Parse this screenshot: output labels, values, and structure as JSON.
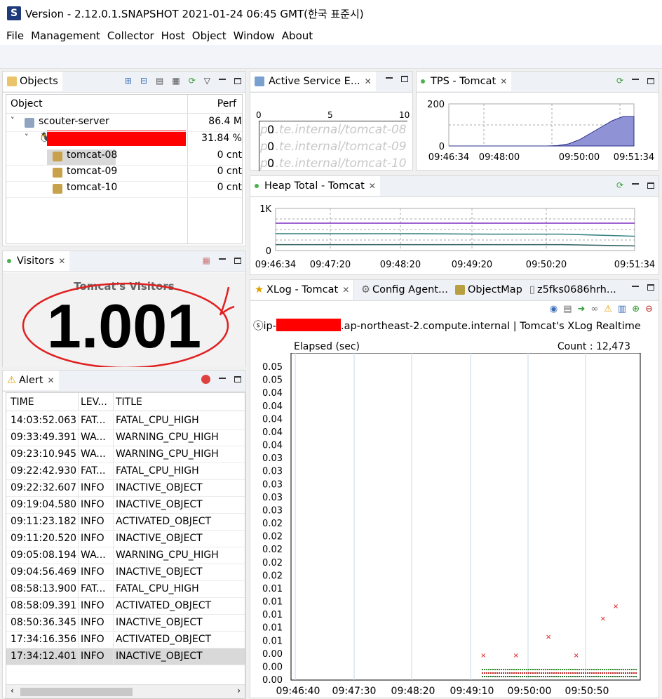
{
  "window": {
    "title": "Version - 2.12.0.1.SNAPSHOT 2021-01-24 06:45 GMT(한국 표준시)"
  },
  "menu": [
    "File",
    "Management",
    "Collector",
    "Host",
    "Object",
    "Window",
    "About"
  ],
  "objects": {
    "tab": "Objects",
    "col_object": "Object",
    "col_perf": "Perf",
    "rows": [
      {
        "name": "scouter-server",
        "perf": "86.4 M",
        "level": 0
      },
      {
        "name": "",
        "perf": "31.84 %",
        "level": 1
      },
      {
        "name": "tomcat-08",
        "perf": "0 cnt",
        "level": 2
      },
      {
        "name": "tomcat-09",
        "perf": "0 cnt",
        "level": 2
      },
      {
        "name": "tomcat-10",
        "perf": "0 cnt",
        "level": 2
      }
    ]
  },
  "visitors": {
    "tab": "Visitors",
    "heading": "Tomcat's  Visitors",
    "value": "1.001"
  },
  "alert": {
    "tab": "Alert",
    "cols": [
      "TIME",
      "LEV...",
      "TITLE"
    ],
    "rows": [
      [
        "14:03:52.063",
        "FAT...",
        "FATAL_CPU_HIGH"
      ],
      [
        "09:33:49.391",
        "WA...",
        "WARNING_CPU_HIGH"
      ],
      [
        "09:23:10.945",
        "WA...",
        "WARNING_CPU_HIGH"
      ],
      [
        "09:22:42.930",
        "FAT...",
        "FATAL_CPU_HIGH"
      ],
      [
        "09:22:32.607",
        "INFO",
        "INACTIVE_OBJECT"
      ],
      [
        "09:19:04.580",
        "INFO",
        "INACTIVE_OBJECT"
      ],
      [
        "09:11:23.182",
        "INFO",
        "ACTIVATED_OBJECT"
      ],
      [
        "09:11:20.520",
        "INFO",
        "INACTIVE_OBJECT"
      ],
      [
        "09:05:08.194",
        "WA...",
        "WARNING_CPU_HIGH"
      ],
      [
        "09:04:56.469",
        "INFO",
        "INACTIVE_OBJECT"
      ],
      [
        "08:58:13.900",
        "FAT...",
        "FATAL_CPU_HIGH"
      ],
      [
        "08:58:09.391",
        "INFO",
        "ACTIVATED_OBJECT"
      ],
      [
        "08:50:36.345",
        "INFO",
        "INACTIVE_OBJECT"
      ],
      [
        "17:34:16.356",
        "INFO",
        "ACTIVATED_OBJECT"
      ],
      [
        "17:34:12.401",
        "INFO",
        "INACTIVE_OBJECT"
      ]
    ]
  },
  "active_service": {
    "tab": "Active Service E...",
    "axis": [
      "0",
      "5",
      "10"
    ],
    "rows": [
      {
        "value": "0",
        "label": "p...te.internal/tomcat-08"
      },
      {
        "value": "0",
        "label": "p...te.internal/tomcat-09"
      },
      {
        "value": "0",
        "label": "p...te.internal/tomcat-10"
      }
    ]
  },
  "tps": {
    "tab": "TPS - Tomcat"
  },
  "heap": {
    "tab": "Heap Total - Tomcat"
  },
  "xlog": {
    "tabs": [
      "XLog - Tomcat",
      "Config Agent...",
      "ObjectMap",
      "z5fks0686hrh..."
    ],
    "subtitle_prefix": "ip-",
    "subtitle_suffix": ".ap-northeast-2.compute.internal | Tomcat's XLog Realtime",
    "elapsed_label": "Elapsed (sec)",
    "count_label": "Count : 12,473"
  },
  "chart_data": [
    {
      "type": "area",
      "title": "TPS - Tomcat",
      "x": [
        "09:46:34",
        "09:48:00",
        "09:50:00",
        "09:51:34"
      ],
      "ylim": [
        0,
        200
      ],
      "yticks": [
        "0",
        "200"
      ],
      "series": [
        {
          "values": [
            0,
            0,
            0,
            0,
            0,
            0,
            0,
            0,
            0,
            0,
            2,
            10,
            30,
            60,
            90,
            120,
            140,
            140
          ]
        }
      ]
    },
    {
      "type": "line",
      "title": "Heap Total - Tomcat",
      "x": [
        "09:46:34",
        "09:47:20",
        "09:48:20",
        "09:49:20",
        "09:50:20",
        "09:51:34"
      ],
      "ylim": [
        0,
        1000
      ],
      "yticks": [
        "0",
        "1K"
      ],
      "series": [
        {
          "color": "#7b2fbf",
          "values": [
            650,
            650,
            650,
            650,
            650,
            650
          ]
        },
        {
          "color": "#2e7d7d",
          "values": [
            400,
            400,
            400,
            390,
            390,
            340
          ]
        },
        {
          "color": "#2e5d5d",
          "values": [
            140,
            140,
            140,
            140,
            140,
            110
          ]
        }
      ]
    },
    {
      "type": "scatter",
      "title": "Tomcat's XLog Realtime",
      "xticks": [
        "09:46:40",
        "09:47:30",
        "09:48:20",
        "09:49:10",
        "09:50:00",
        "09:50:50"
      ],
      "yticks": [
        "0.00",
        "0.00",
        "0.00",
        "0.01",
        "0.01",
        "0.01",
        "0.01",
        "0.01",
        "0.02",
        "0.02",
        "0.02",
        "0.02",
        "0.02",
        "0.03",
        "0.03",
        "0.03",
        "0.03",
        "0.03",
        "0.04",
        "0.04",
        "0.04",
        "0.04",
        "0.04",
        "0.05",
        "0.05"
      ],
      "points": [
        {
          "x": "09:49:22",
          "y": 0.003
        },
        {
          "x": "09:49:50",
          "y": 0.003
        },
        {
          "x": "09:50:18",
          "y": 0.006
        },
        {
          "x": "09:50:42",
          "y": 0.003
        },
        {
          "x": "09:51:05",
          "y": 0.009
        },
        {
          "x": "09:51:16",
          "y": 0.011
        }
      ]
    }
  ]
}
